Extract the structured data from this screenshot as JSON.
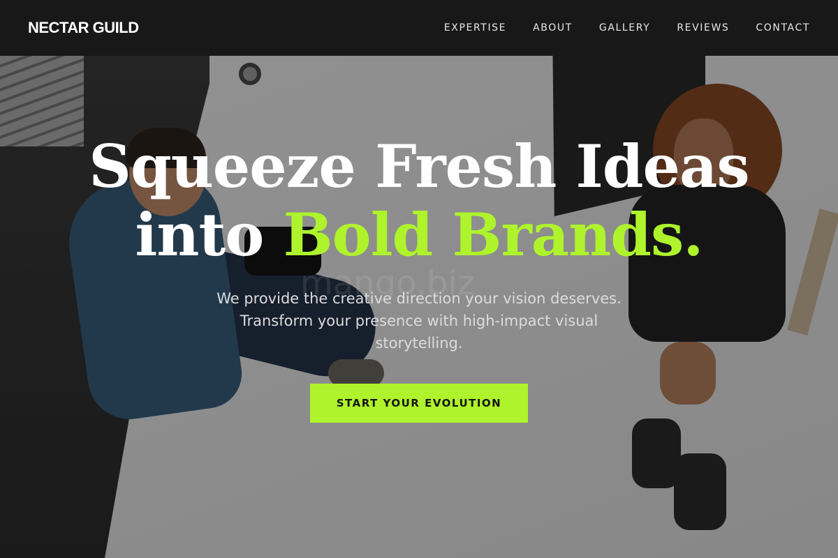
{
  "brand": {
    "name": "NECTAR GUILD"
  },
  "nav": {
    "items": [
      {
        "label": "EXPERTISE"
      },
      {
        "label": "ABOUT"
      },
      {
        "label": "GALLERY"
      },
      {
        "label": "REVIEWS"
      },
      {
        "label": "CONTACT"
      }
    ]
  },
  "hero": {
    "headline_line1": "Squeeze Fresh Ideas",
    "headline_line2_prefix": "into ",
    "headline_line2_accent": "Bold Brands.",
    "subtext": "We provide the creative direction your vision deserves. Transform your presence with high-impact visual storytelling.",
    "cta_label": "START YOUR EVOLUTION",
    "watermark": "mango.biz"
  },
  "colors": {
    "accent": "#aef32c",
    "navbar": "#181818",
    "text": "#ffffff"
  },
  "images": {
    "hero_background": "photographer-and-model-studio-photo"
  }
}
